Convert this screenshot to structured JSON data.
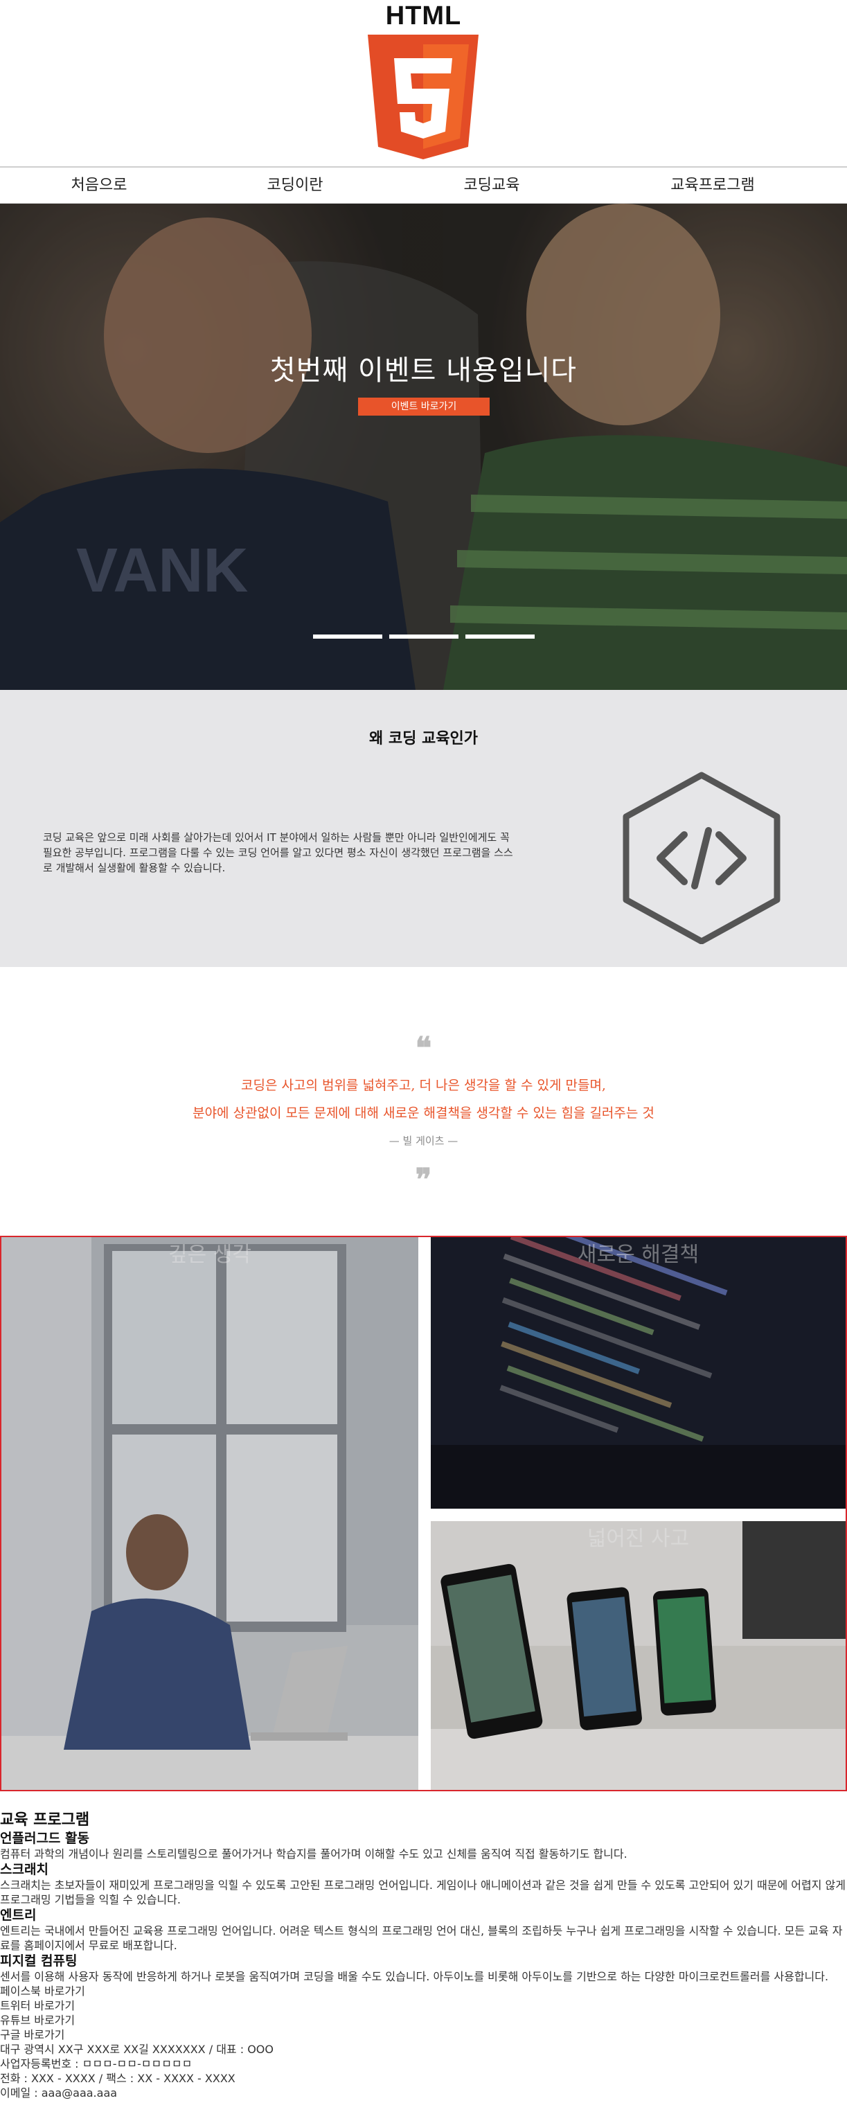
{
  "header": {
    "logo_text": "HTML",
    "logo_digit": "5"
  },
  "nav": {
    "items": [
      {
        "label": "처음으로"
      },
      {
        "label": "코딩이란"
      },
      {
        "label": "코딩교육"
      },
      {
        "label": "교육프로그램"
      }
    ]
  },
  "hero": {
    "title": "첫번째 이벤트 내용입니다",
    "button_label": "이벤트 바로가기",
    "slides": 3,
    "active_slide": 1
  },
  "why": {
    "title": "왜 코딩 교육인가",
    "text": "코딩 교육은 앞으로 미래 사회를 살아가는데 있어서 IT 분야에서 일하는 사람들 뿐만 아니라 일반인에게도 꼭 필요한 공부입니다. 프로그램을 다룰 수 있는 코딩 언어를 알고 있다면 평소 자신이 생각했던 프로그램을 스스로 개발해서 실생활에 활용할 수 있습니다.",
    "icon": "code-icon"
  },
  "quote": {
    "open_mark": "❝",
    "close_mark": "❞",
    "line1": "코딩은 사고의 범위를 넓혀주고, 더 나은 생각을 할 수 있게 만들며,",
    "line2": "분야에 상관없이 모든 문제에 대해 새로운 해결책을 생각할 수 있는 힘을 길러주는 것",
    "author": "— 빌 게이츠 —"
  },
  "gallery": {
    "tiles": [
      {
        "caption": "깊은 생각"
      },
      {
        "caption": "새로운 해결책"
      },
      {
        "caption": "넓어진 사고"
      }
    ]
  },
  "program": {
    "title": "교육 프로그램",
    "items": [
      {
        "name": "언플러그드 활동",
        "desc": "컴퓨터 과학의 개념이나 원리를 스토리텔링으로 풀어가거나 학습지를 풀어가며 이해할 수도 있고 신체를 움직여 직접 활동하기도 합니다."
      },
      {
        "name": "스크래치",
        "desc": "스크래치는 초보자들이 재미있게 프로그래밍을 익힐 수 있도록 고안된 프로그래밍 언어입니다. 게임이나 애니메이션과 같은 것을 쉽게 만들 수 있도록 고안되어 있기 때문에 어렵지 않게 프로그래밍 기법들을 익힐 수 있습니다."
      },
      {
        "name": "엔트리",
        "desc": "엔트리는 국내에서 만들어진 교육용 프로그래밍 언어입니다. 어려운 텍스트 형식의 프로그래밍 언어 대신, 블록의 조립하듯 누구나 쉽게 프로그래밍을 시작할 수 있습니다. 모든 교육 자료를 홈페이지에서 무료로 배포합니다."
      },
      {
        "name": "피지컬 컴퓨팅",
        "desc": "센서를 이용해 사용자 동작에 반응하게 하거나 로봇을 움직여가며 코딩을 배울 수도 있습니다. 아두이노를 비롯해 아두이노를 기반으로 하는 다양한 마이크로컨트롤러를 사용합니다."
      }
    ]
  },
  "footer": {
    "links": [
      "페이스북 바로가기",
      "트위터 바로가기",
      "유튜브 바로가기",
      "구글 바로가기"
    ],
    "address": "대구 광역시 XX구 XXX로 XX길 XXXXXXX / 대표 : OOO",
    "business_no": "사업자등록번호 : ㅁㅁㅁ-ㅁㅁ-ㅁㅁㅁㅁㅁ",
    "phone": "전화 : XXX - XXXX / 팩스 : XX - XXXX - XXXX",
    "email": "이메일 : aaa@aaa.aaa"
  }
}
